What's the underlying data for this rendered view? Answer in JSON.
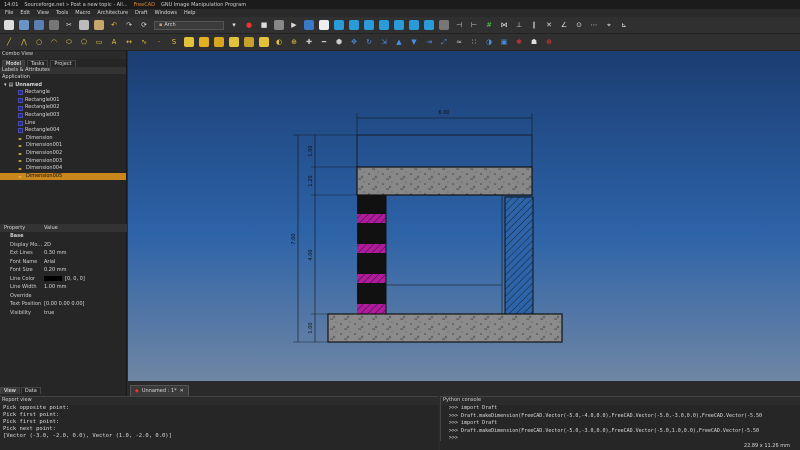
{
  "taskbar": {
    "time": "14:01",
    "items": [
      "Sourceforge.net » Post a new topic - All...",
      "FreeCAD",
      "GNU Image Manipulation Program"
    ]
  },
  "menu": [
    "File",
    "Edit",
    "View",
    "Tools",
    "Macro",
    "Architecture",
    "Draft",
    "Windows",
    "Help"
  ],
  "workbench": "Arch",
  "combo_view": {
    "title": "Combo View",
    "tabs": [
      "Model",
      "Tasks",
      "Project"
    ],
    "labels_section": "Labels & Attributes",
    "application": "Application",
    "document": "Unnamed",
    "items": [
      {
        "label": "Rectangle",
        "kind": "rect"
      },
      {
        "label": "Rectangle001",
        "kind": "rect"
      },
      {
        "label": "Rectangle002",
        "kind": "rect"
      },
      {
        "label": "Rectangle003",
        "kind": "rect"
      },
      {
        "label": "Line",
        "kind": "rect"
      },
      {
        "label": "Rectangle004",
        "kind": "rect"
      },
      {
        "label": "Dimension",
        "kind": "dim"
      },
      {
        "label": "Dimension001",
        "kind": "dim"
      },
      {
        "label": "Dimension002",
        "kind": "dim"
      },
      {
        "label": "Dimension003",
        "kind": "dim"
      },
      {
        "label": "Dimension004",
        "kind": "dim"
      },
      {
        "label": "Dimension005",
        "kind": "dim",
        "selected": true
      }
    ]
  },
  "properties": {
    "col_property": "Property",
    "col_value": "Value",
    "group": "Base",
    "rows": [
      {
        "key": "Display Mo...",
        "value": "2D"
      },
      {
        "key": "Ext Lines",
        "value": "0.30 mm"
      },
      {
        "key": "Font Name",
        "value": "Arial"
      },
      {
        "key": "Font Size",
        "value": "0.20 mm"
      },
      {
        "key": "Line Color",
        "value": "[0, 0, 0]"
      },
      {
        "key": "Line Width",
        "value": "1.00 mm"
      },
      {
        "key": "Override",
        "value": ""
      },
      {
        "key": "Text Position",
        "value": "[0.00 0.00 0.00]"
      },
      {
        "key": "Visibility",
        "value": "true"
      }
    ],
    "bottom_tabs": [
      "View",
      "Data"
    ]
  },
  "drawing": {
    "dim_top": "6.00",
    "dim_left_total": "7.00",
    "dim_left_1": "1.00",
    "dim_left_2": "1.20",
    "dim_left_3": "4.00",
    "dim_left_4": "1.00"
  },
  "document_tab": "Unnamed : 1*",
  "report_view": {
    "title": "Report view",
    "lines": [
      "Pick opposite point:",
      "Pick first point:",
      "Pick first point:",
      "Pick next point:",
      "[Vector (-3.0, -2.0, 0.0), Vector (1.0, -2.0, 0.0)]"
    ]
  },
  "python_console": {
    "title": "Python console",
    "lines": [
      ">>> import Draft",
      ">>> Draft.makeDimension(FreeCAD.Vector(-5.0,-4.0,0.0),FreeCAD.Vector(-5.0,-3.0,0.0),FreeCAD.Vector(-5.50",
      ">>> import Draft",
      ">>> Draft.makeDimension(FreeCAD.Vector(-5.0,-3.0,0.0),FreeCAD.Vector(-5.0,1.0,0.0),FreeCAD.Vector(-5.50",
      ">>> "
    ]
  },
  "status": "22.89 x 11.26 mm",
  "colors": {
    "accent": "#c8861d",
    "viewport_top": "#1b3e73",
    "viewport_bottom": "#6f86a4",
    "magenta_fill": "#b01a9c"
  }
}
